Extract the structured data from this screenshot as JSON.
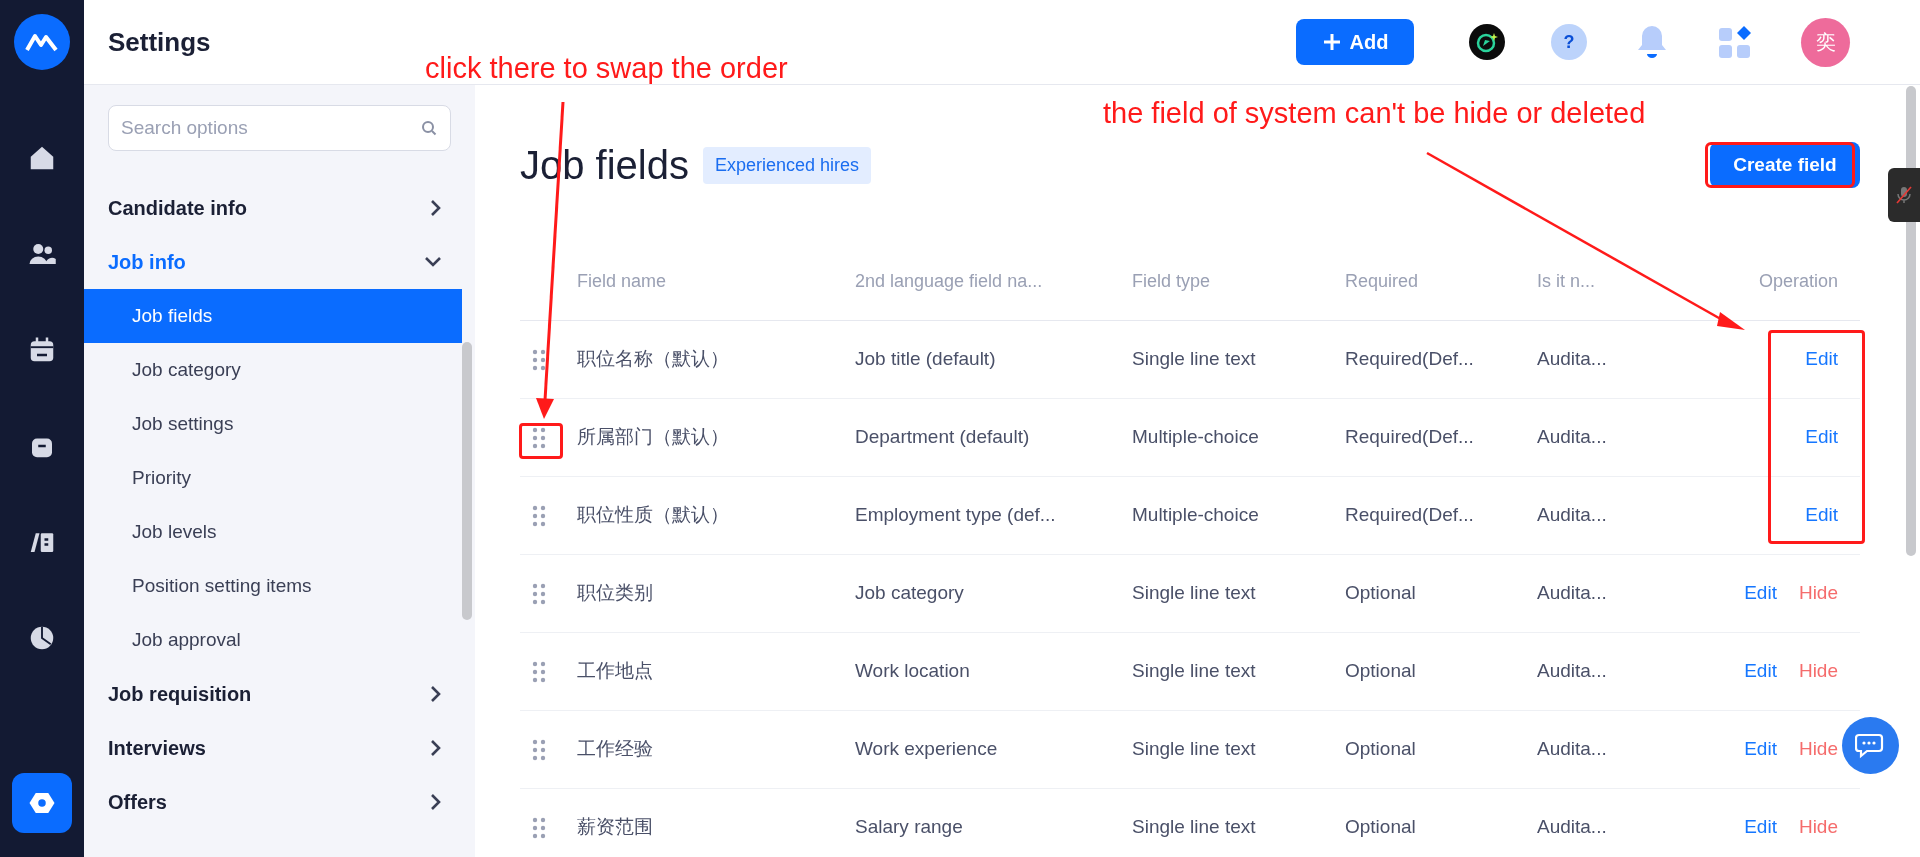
{
  "rail": [
    {
      "selected": false
    },
    {
      "selected": false
    },
    {
      "selected": false
    },
    {
      "selected": false
    },
    {
      "selected": false
    },
    {
      "selected": false
    },
    {
      "selected": true
    }
  ],
  "header": {
    "title": "Settings",
    "add_button": "Add",
    "help_glyph": "?",
    "avatar": "奕"
  },
  "sidebar": {
    "search": {
      "placeholder": "Search options"
    },
    "items": [
      {
        "label": "Candidate info",
        "expanded": false,
        "selected": false
      },
      {
        "label": "Job info",
        "expanded": true,
        "selected": false,
        "children": [
          {
            "label": "Job fields",
            "selected": true
          },
          {
            "label": "Job category",
            "selected": false
          },
          {
            "label": "Job settings",
            "selected": false
          },
          {
            "label": "Priority",
            "selected": false
          },
          {
            "label": "Job levels",
            "selected": false
          },
          {
            "label": "Position setting items",
            "selected": false
          },
          {
            "label": "Job approval",
            "selected": false
          }
        ]
      },
      {
        "label": "Job requisition",
        "expanded": false,
        "selected": false
      },
      {
        "label": "Interviews",
        "expanded": false,
        "selected": false
      },
      {
        "label": "Offers",
        "expanded": false,
        "selected": false
      }
    ]
  },
  "page": {
    "title": "Job fields",
    "badge": "Experienced hires",
    "create_button": "Create field"
  },
  "table": {
    "columns": [
      "Field name",
      "2nd language field na...",
      "Field type",
      "Required",
      "Is it n...",
      "Operation"
    ],
    "rows": [
      {
        "cells": [
          "职位名称（默认）",
          "Job title (default)",
          "Single line text",
          "Required(Def...",
          "Audita..."
        ],
        "operations": [
          {
            "kind": "edit",
            "label": "Edit"
          }
        ]
      },
      {
        "cells": [
          "所属部门（默认）",
          "Department (default)",
          "Multiple-choice",
          "Required(Def...",
          "Audita..."
        ],
        "operations": [
          {
            "kind": "edit",
            "label": "Edit"
          }
        ]
      },
      {
        "cells": [
          "职位性质（默认）",
          "Employment type (def...",
          "Multiple-choice",
          "Required(Def...",
          "Audita..."
        ],
        "operations": [
          {
            "kind": "edit",
            "label": "Edit"
          }
        ]
      },
      {
        "cells": [
          "职位类别",
          "Job category",
          "Single line text",
          "Optional",
          "Audita..."
        ],
        "operations": [
          {
            "kind": "edit",
            "label": "Edit"
          },
          {
            "kind": "hide",
            "label": "Hide"
          }
        ]
      },
      {
        "cells": [
          "工作地点",
          "Work location",
          "Single line text",
          "Optional",
          "Audita..."
        ],
        "operations": [
          {
            "kind": "edit",
            "label": "Edit"
          },
          {
            "kind": "hide",
            "label": "Hide"
          }
        ]
      },
      {
        "cells": [
          "工作经验",
          "Work experience",
          "Single line text",
          "Optional",
          "Audita..."
        ],
        "operations": [
          {
            "kind": "edit",
            "label": "Edit"
          },
          {
            "kind": "hide",
            "label": "Hide"
          }
        ]
      },
      {
        "cells": [
          "薪资范围",
          "Salary range",
          "Single line text",
          "Optional",
          "Audita..."
        ],
        "operations": [
          {
            "kind": "edit",
            "label": "Edit"
          },
          {
            "kind": "hide",
            "label": "Hide"
          }
        ]
      }
    ]
  },
  "annotations": [
    {
      "text": "click there to swap the order"
    },
    {
      "text": "the field of system can't be hide or deleted"
    }
  ]
}
